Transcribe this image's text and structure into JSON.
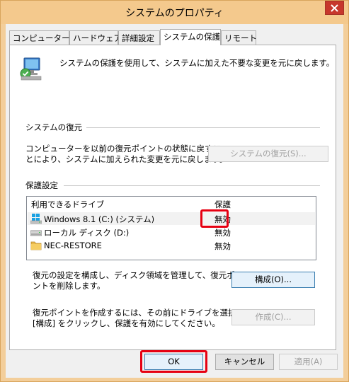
{
  "window": {
    "title": "システムのプロパティ"
  },
  "tabs": [
    {
      "label": "コンピューター名"
    },
    {
      "label": "ハードウェア"
    },
    {
      "label": "詳細設定"
    },
    {
      "label": "システムの保護"
    },
    {
      "label": "リモート"
    }
  ],
  "intro": {
    "text": "システムの保護を使用して、システムに加えた不要な変更を元に戻します。"
  },
  "restore": {
    "section_label": "システムの復元",
    "text_line1": "コンピューターを以前の復元ポイントの状態に戻すこ",
    "text_line2": "とにより、システムに加えられた変更を元に戻します。",
    "button_label": "システムの復元(S)..."
  },
  "protection": {
    "section_label": "保護設定",
    "columns": [
      "利用できるドライブ",
      "保護"
    ],
    "drives": [
      {
        "name": "Windows 8.1 (C:) (システム)",
        "status": "無効",
        "icon": "windows-drive-icon"
      },
      {
        "name": "ローカル ディスク (D:)",
        "status": "無効",
        "icon": "local-disk-icon"
      },
      {
        "name": "NEC-RESTORE",
        "status": "無効",
        "icon": "folder-icon"
      }
    ]
  },
  "configure": {
    "text_line1": "復元の設定を構成し、ディスク領域を管理して、復元ポイ",
    "text_line2": "ントを削除します。",
    "button_label": "構成(O)..."
  },
  "create": {
    "text_line1": "復元ポイントを作成するには、その前にドライブを選択して",
    "text_line2": "[構成] をクリックし、保護を有効にしてください。",
    "button_label": "作成(C)..."
  },
  "footer": {
    "ok_label": "OK",
    "cancel_label": "キャンセル",
    "apply_label": "適用(A)"
  },
  "colors": {
    "highlight": "#e60012",
    "title_bar": "#f4c98d",
    "close_button": "#c7372c"
  }
}
